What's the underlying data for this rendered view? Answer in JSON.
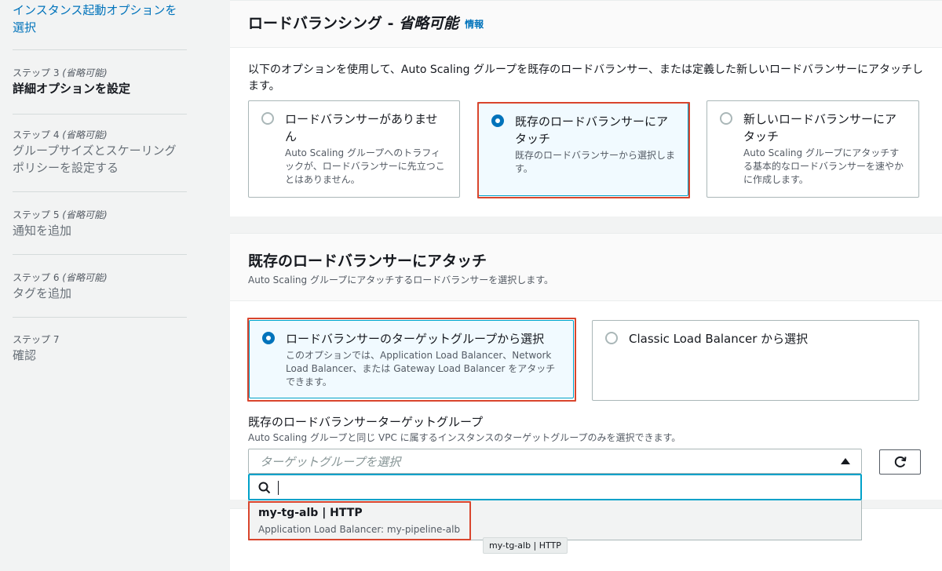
{
  "sidebar": {
    "step2_title": "インスタンス起動オプションを選択",
    "step3": {
      "kicker": "ステップ 3",
      "optional": "(省略可能)",
      "title": "詳細オプションを設定"
    },
    "step4": {
      "kicker": "ステップ 4",
      "optional": "(省略可能)",
      "title": "グループサイズとスケーリングポリシーを設定する"
    },
    "step5": {
      "kicker": "ステップ 5",
      "optional": "(省略可能)",
      "title": "通知を追加"
    },
    "step6": {
      "kicker": "ステップ 6",
      "optional": "(省略可能)",
      "title": "タグを追加"
    },
    "step7": {
      "kicker": "ステップ 7",
      "title": "確認"
    }
  },
  "lb_section": {
    "title": "ロードバランシング - ",
    "title_optional": "省略可能",
    "info": "情報",
    "description": "以下のオプションを使用して、Auto Scaling グループを既存のロードバランサー、または定義した新しいロードバランサーにアタッチします。",
    "options": [
      {
        "label": "ロードバランサーがありません",
        "desc": "Auto Scaling グループへのトラフィックが、ロードバランサーに先立つことはありません。",
        "selected": false
      },
      {
        "label": "既存のロードバランサーにアタッチ",
        "desc": "既存のロードバランサーから選択します。",
        "selected": true
      },
      {
        "label": "新しいロードバランサーにアタッチ",
        "desc": "Auto Scaling グループにアタッチする基本的なロードバランサーを速やかに作成します。",
        "selected": false
      }
    ]
  },
  "attach_section": {
    "title": "既存のロードバランサーにアタッチ",
    "description": "Auto Scaling グループにアタッチするロードバランサーを選択します。",
    "options": [
      {
        "label": "ロードバランサーのターゲットグループから選択",
        "desc": "このオプションでは、Application Load Balancer、Network Load Balancer、または Gateway Load Balancer をアタッチできます。",
        "selected": true
      },
      {
        "label": "Classic Load Balancer から選択",
        "selected": false
      }
    ],
    "target_group": {
      "label": "既存のロードバランサーターゲットグループ",
      "description": "Auto Scaling グループと同じ VPC に属するインスタンスのターゲットグループのみを選択できます。",
      "placeholder": "ターゲットグループを選択",
      "search_value": "",
      "dropdown_items": [
        {
          "title": "my-tg-alb | HTTP",
          "subtitle": "Application Load Balancer: my-pipeline-alb"
        }
      ],
      "tooltip": "my-tg-alb | HTTP"
    }
  },
  "colors": {
    "accent": "#0073bb",
    "selected_border": "#00a1c9",
    "annotation_red": "#d9452d"
  }
}
